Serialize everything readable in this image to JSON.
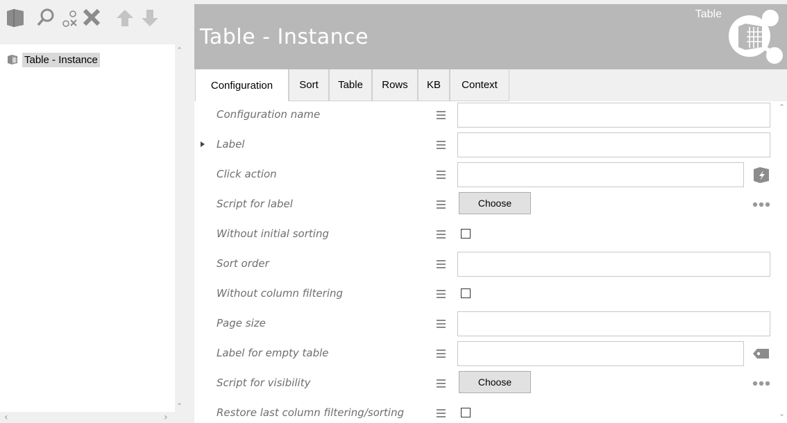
{
  "toolbar": {
    "icons": [
      "folder-icon",
      "search-icon",
      "disconnect-icon",
      "delete-icon",
      "move-up-icon",
      "move-down-icon"
    ]
  },
  "tree": {
    "items": [
      {
        "label": "Table - Instance",
        "icon": "table-icon"
      }
    ]
  },
  "header": {
    "title": "Table - Instance",
    "type": "Table",
    "bg_color": "#b8b8b8"
  },
  "tabs": [
    {
      "label": "Configuration",
      "active": true
    },
    {
      "label": "Sort",
      "active": false
    },
    {
      "label": "Table",
      "active": false
    },
    {
      "label": "Rows",
      "active": false
    },
    {
      "label": "KB",
      "active": false
    },
    {
      "label": "Context",
      "active": false
    }
  ],
  "form": {
    "rows": [
      {
        "label": "Configuration name",
        "control": "text",
        "value": ""
      },
      {
        "label": "Label",
        "control": "text",
        "value": "",
        "expandable": true
      },
      {
        "label": "Click action",
        "control": "text",
        "value": "",
        "side_icon": "action-icon"
      },
      {
        "label": "Script for label",
        "control": "button",
        "button_label": "Choose",
        "side_icon": "more-icon"
      },
      {
        "label": "Without initial sorting",
        "control": "checkbox",
        "checked": false
      },
      {
        "label": "Sort order",
        "control": "text",
        "value": ""
      },
      {
        "label": "Without column filtering",
        "control": "checkbox",
        "checked": false
      },
      {
        "label": "Page size",
        "control": "text",
        "value": ""
      },
      {
        "label": "Label for empty table",
        "control": "text",
        "value": "",
        "side_icon": "tag-icon"
      },
      {
        "label": "Script for visibility",
        "control": "button",
        "button_label": "Choose",
        "side_icon": "more-icon"
      },
      {
        "label": "Restore last column filtering/sorting",
        "control": "checkbox",
        "checked": false
      }
    ]
  },
  "colors": {
    "icon_gray": "#8c8c8c",
    "label_gray": "#6e6e6e"
  }
}
